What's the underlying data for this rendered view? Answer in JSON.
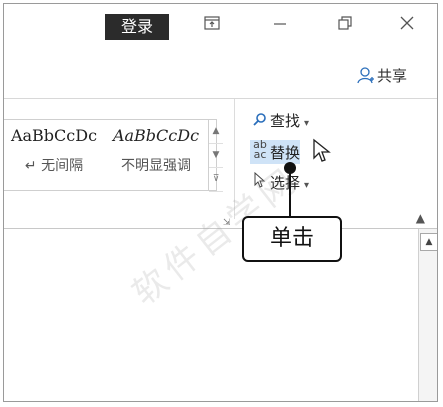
{
  "titlebar": {
    "login_label": "登录",
    "icons": [
      "ribbon-display-icon",
      "minimize-icon",
      "restore-icon",
      "close-icon"
    ]
  },
  "share": {
    "label": "共享",
    "icon": "person-add-icon"
  },
  "styles": {
    "items": [
      {
        "sample": "AaBbCcDc",
        "name": "↵ 无间隔"
      },
      {
        "sample": "AaBbCcDc",
        "name": "不明显强调"
      }
    ]
  },
  "editing": {
    "find_label": "查找",
    "replace_label": "替换",
    "select_label": "选择"
  },
  "callout": {
    "label": "单击"
  },
  "colors": {
    "login_bg": "#2b2b2b",
    "accent": "#2a6ebb",
    "highlight": "#cfe3f7"
  }
}
